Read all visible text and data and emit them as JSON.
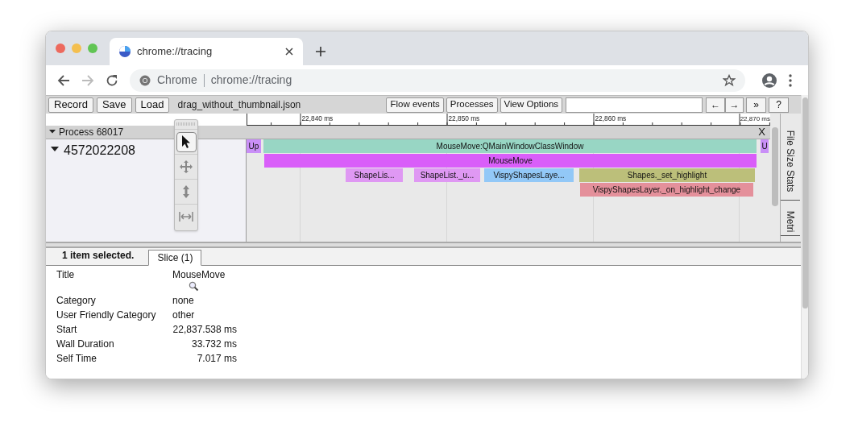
{
  "browser": {
    "tab": {
      "title": "chrome://tracing"
    },
    "omnibox": {
      "site_label": "Chrome",
      "url": "chrome://tracing"
    }
  },
  "tracing_toolbar": {
    "left_buttons": [
      "Record",
      "Save",
      "Load"
    ],
    "filename": "drag_without_thumbnail.json",
    "right_buttons": [
      "Flow events",
      "Processes",
      "View Options"
    ],
    "nav_buttons": [
      "←",
      "→",
      "»",
      "?"
    ]
  },
  "ruler": {
    "ticks": [
      "22,840 ms",
      "22,850 ms",
      "22,860 ms",
      "22,870 ms"
    ]
  },
  "process": {
    "label": "Process 68017",
    "expanded": true,
    "close": "X",
    "threads": [
      {
        "label": "4572022208",
        "expanded": true,
        "slices": [
          {
            "label": "Up",
            "color": "#c98ff7"
          },
          {
            "label": "MouseMove:QMainWindowClassWindow",
            "color": "#98d6c4",
            "children": [
              {
                "label": "MouseMove",
                "color": "#d95ef9",
                "children": [
                  {
                    "label": "ShapeLis...",
                    "color": "#df98f3"
                  },
                  {
                    "label": "ShapeList._u...",
                    "color": "#df98f3"
                  },
                  {
                    "label": "VispyShapesLaye...",
                    "color": "#92c8f7"
                  },
                  {
                    "label": "Shapes._set_highlight",
                    "color": "#bcbf7a",
                    "children": [
                      {
                        "label": "VispyShapesLayer._on_highlight_change",
                        "color": "#e4909b"
                      }
                    ]
                  }
                ]
              }
            ]
          },
          {
            "label": "U",
            "color": "#c98ff7"
          }
        ]
      }
    ]
  },
  "mouse_modes": [
    {
      "kind": "select",
      "selected": true
    },
    {
      "kind": "pan",
      "selected": false
    },
    {
      "kind": "zoom",
      "selected": false
    },
    {
      "kind": "timing",
      "selected": false
    }
  ],
  "side_tabs": [
    "File Size Stats",
    "Metri"
  ],
  "analysis": {
    "summary": "1 item selected.",
    "tabs": [
      {
        "label": "Slice (1)",
        "selected": true
      }
    ],
    "rows": [
      {
        "label": "Title",
        "value": "MouseMove",
        "kind": "text",
        "search": true
      },
      {
        "label": "Category",
        "value": "none",
        "kind": "text"
      },
      {
        "label": "User Friendly Category",
        "value": "other",
        "kind": "text"
      },
      {
        "label": "Start",
        "value": "22,837.538 ms",
        "kind": "number"
      },
      {
        "label": "Wall Duration",
        "value": "33.732 ms",
        "kind": "number"
      },
      {
        "label": "Self Time",
        "value": "7.017 ms",
        "kind": "number"
      }
    ]
  }
}
